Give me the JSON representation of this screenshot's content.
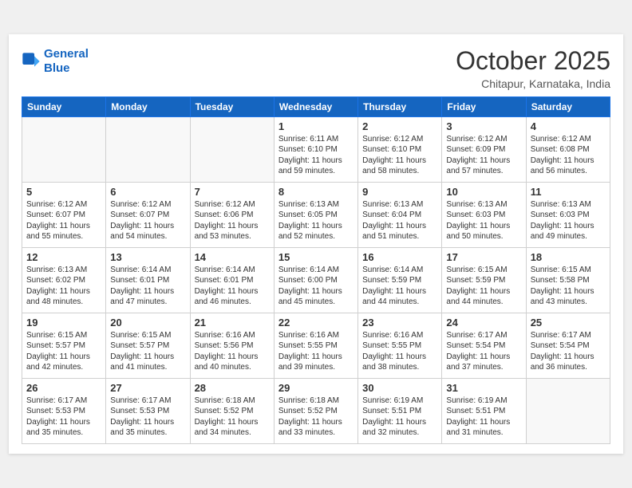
{
  "header": {
    "logo_line1": "General",
    "logo_line2": "Blue",
    "month": "October 2025",
    "location": "Chitapur, Karnataka, India"
  },
  "weekdays": [
    "Sunday",
    "Monday",
    "Tuesday",
    "Wednesday",
    "Thursday",
    "Friday",
    "Saturday"
  ],
  "weeks": [
    [
      {
        "day": "",
        "empty": true
      },
      {
        "day": "",
        "empty": true
      },
      {
        "day": "",
        "empty": true
      },
      {
        "day": "1",
        "sunrise": "6:11 AM",
        "sunset": "6:10 PM",
        "daylight": "11 hours and 59 minutes."
      },
      {
        "day": "2",
        "sunrise": "6:12 AM",
        "sunset": "6:10 PM",
        "daylight": "11 hours and 58 minutes."
      },
      {
        "day": "3",
        "sunrise": "6:12 AM",
        "sunset": "6:09 PM",
        "daylight": "11 hours and 57 minutes."
      },
      {
        "day": "4",
        "sunrise": "6:12 AM",
        "sunset": "6:08 PM",
        "daylight": "11 hours and 56 minutes."
      }
    ],
    [
      {
        "day": "5",
        "sunrise": "6:12 AM",
        "sunset": "6:07 PM",
        "daylight": "11 hours and 55 minutes."
      },
      {
        "day": "6",
        "sunrise": "6:12 AM",
        "sunset": "6:07 PM",
        "daylight": "11 hours and 54 minutes."
      },
      {
        "day": "7",
        "sunrise": "6:12 AM",
        "sunset": "6:06 PM",
        "daylight": "11 hours and 53 minutes."
      },
      {
        "day": "8",
        "sunrise": "6:13 AM",
        "sunset": "6:05 PM",
        "daylight": "11 hours and 52 minutes."
      },
      {
        "day": "9",
        "sunrise": "6:13 AM",
        "sunset": "6:04 PM",
        "daylight": "11 hours and 51 minutes."
      },
      {
        "day": "10",
        "sunrise": "6:13 AM",
        "sunset": "6:03 PM",
        "daylight": "11 hours and 50 minutes."
      },
      {
        "day": "11",
        "sunrise": "6:13 AM",
        "sunset": "6:03 PM",
        "daylight": "11 hours and 49 minutes."
      }
    ],
    [
      {
        "day": "12",
        "sunrise": "6:13 AM",
        "sunset": "6:02 PM",
        "daylight": "11 hours and 48 minutes."
      },
      {
        "day": "13",
        "sunrise": "6:14 AM",
        "sunset": "6:01 PM",
        "daylight": "11 hours and 47 minutes."
      },
      {
        "day": "14",
        "sunrise": "6:14 AM",
        "sunset": "6:01 PM",
        "daylight": "11 hours and 46 minutes."
      },
      {
        "day": "15",
        "sunrise": "6:14 AM",
        "sunset": "6:00 PM",
        "daylight": "11 hours and 45 minutes."
      },
      {
        "day": "16",
        "sunrise": "6:14 AM",
        "sunset": "5:59 PM",
        "daylight": "11 hours and 44 minutes."
      },
      {
        "day": "17",
        "sunrise": "6:15 AM",
        "sunset": "5:59 PM",
        "daylight": "11 hours and 44 minutes."
      },
      {
        "day": "18",
        "sunrise": "6:15 AM",
        "sunset": "5:58 PM",
        "daylight": "11 hours and 43 minutes."
      }
    ],
    [
      {
        "day": "19",
        "sunrise": "6:15 AM",
        "sunset": "5:57 PM",
        "daylight": "11 hours and 42 minutes."
      },
      {
        "day": "20",
        "sunrise": "6:15 AM",
        "sunset": "5:57 PM",
        "daylight": "11 hours and 41 minutes."
      },
      {
        "day": "21",
        "sunrise": "6:16 AM",
        "sunset": "5:56 PM",
        "daylight": "11 hours and 40 minutes."
      },
      {
        "day": "22",
        "sunrise": "6:16 AM",
        "sunset": "5:55 PM",
        "daylight": "11 hours and 39 minutes."
      },
      {
        "day": "23",
        "sunrise": "6:16 AM",
        "sunset": "5:55 PM",
        "daylight": "11 hours and 38 minutes."
      },
      {
        "day": "24",
        "sunrise": "6:17 AM",
        "sunset": "5:54 PM",
        "daylight": "11 hours and 37 minutes."
      },
      {
        "day": "25",
        "sunrise": "6:17 AM",
        "sunset": "5:54 PM",
        "daylight": "11 hours and 36 minutes."
      }
    ],
    [
      {
        "day": "26",
        "sunrise": "6:17 AM",
        "sunset": "5:53 PM",
        "daylight": "11 hours and 35 minutes."
      },
      {
        "day": "27",
        "sunrise": "6:17 AM",
        "sunset": "5:53 PM",
        "daylight": "11 hours and 35 minutes."
      },
      {
        "day": "28",
        "sunrise": "6:18 AM",
        "sunset": "5:52 PM",
        "daylight": "11 hours and 34 minutes."
      },
      {
        "day": "29",
        "sunrise": "6:18 AM",
        "sunset": "5:52 PM",
        "daylight": "11 hours and 33 minutes."
      },
      {
        "day": "30",
        "sunrise": "6:19 AM",
        "sunset": "5:51 PM",
        "daylight": "11 hours and 32 minutes."
      },
      {
        "day": "31",
        "sunrise": "6:19 AM",
        "sunset": "5:51 PM",
        "daylight": "11 hours and 31 minutes."
      },
      {
        "day": "",
        "empty": true
      }
    ]
  ]
}
